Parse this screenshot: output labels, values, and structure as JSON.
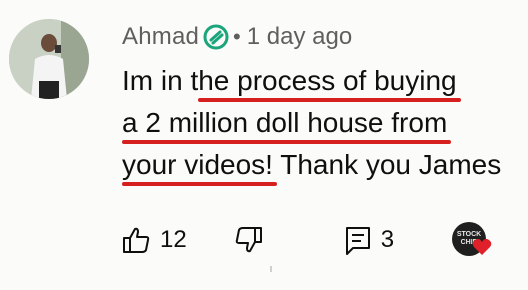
{
  "comment": {
    "author": "Ahmad",
    "separator": "•",
    "timestamp": "1 day ago",
    "text_lines": [
      [
        "Im in t",
        "he process of buying"
      ],
      [
        "",
        "a 2 million doll house from"
      ],
      [
        "",
        "your videos!",
        " Thank you James"
      ]
    ],
    "likes": "12",
    "replies": "3",
    "creator_badge_text": "STOCK CHIP",
    "colors": {
      "underline": "#d6201f",
      "verified_badge": "#1aa57a",
      "heart": "#e0202b"
    }
  },
  "icons": {
    "verified": "verified-icon",
    "like": "thumbs-up-icon",
    "dislike": "thumbs-down-icon",
    "reply": "reply-icon",
    "heart": "heart-icon"
  }
}
